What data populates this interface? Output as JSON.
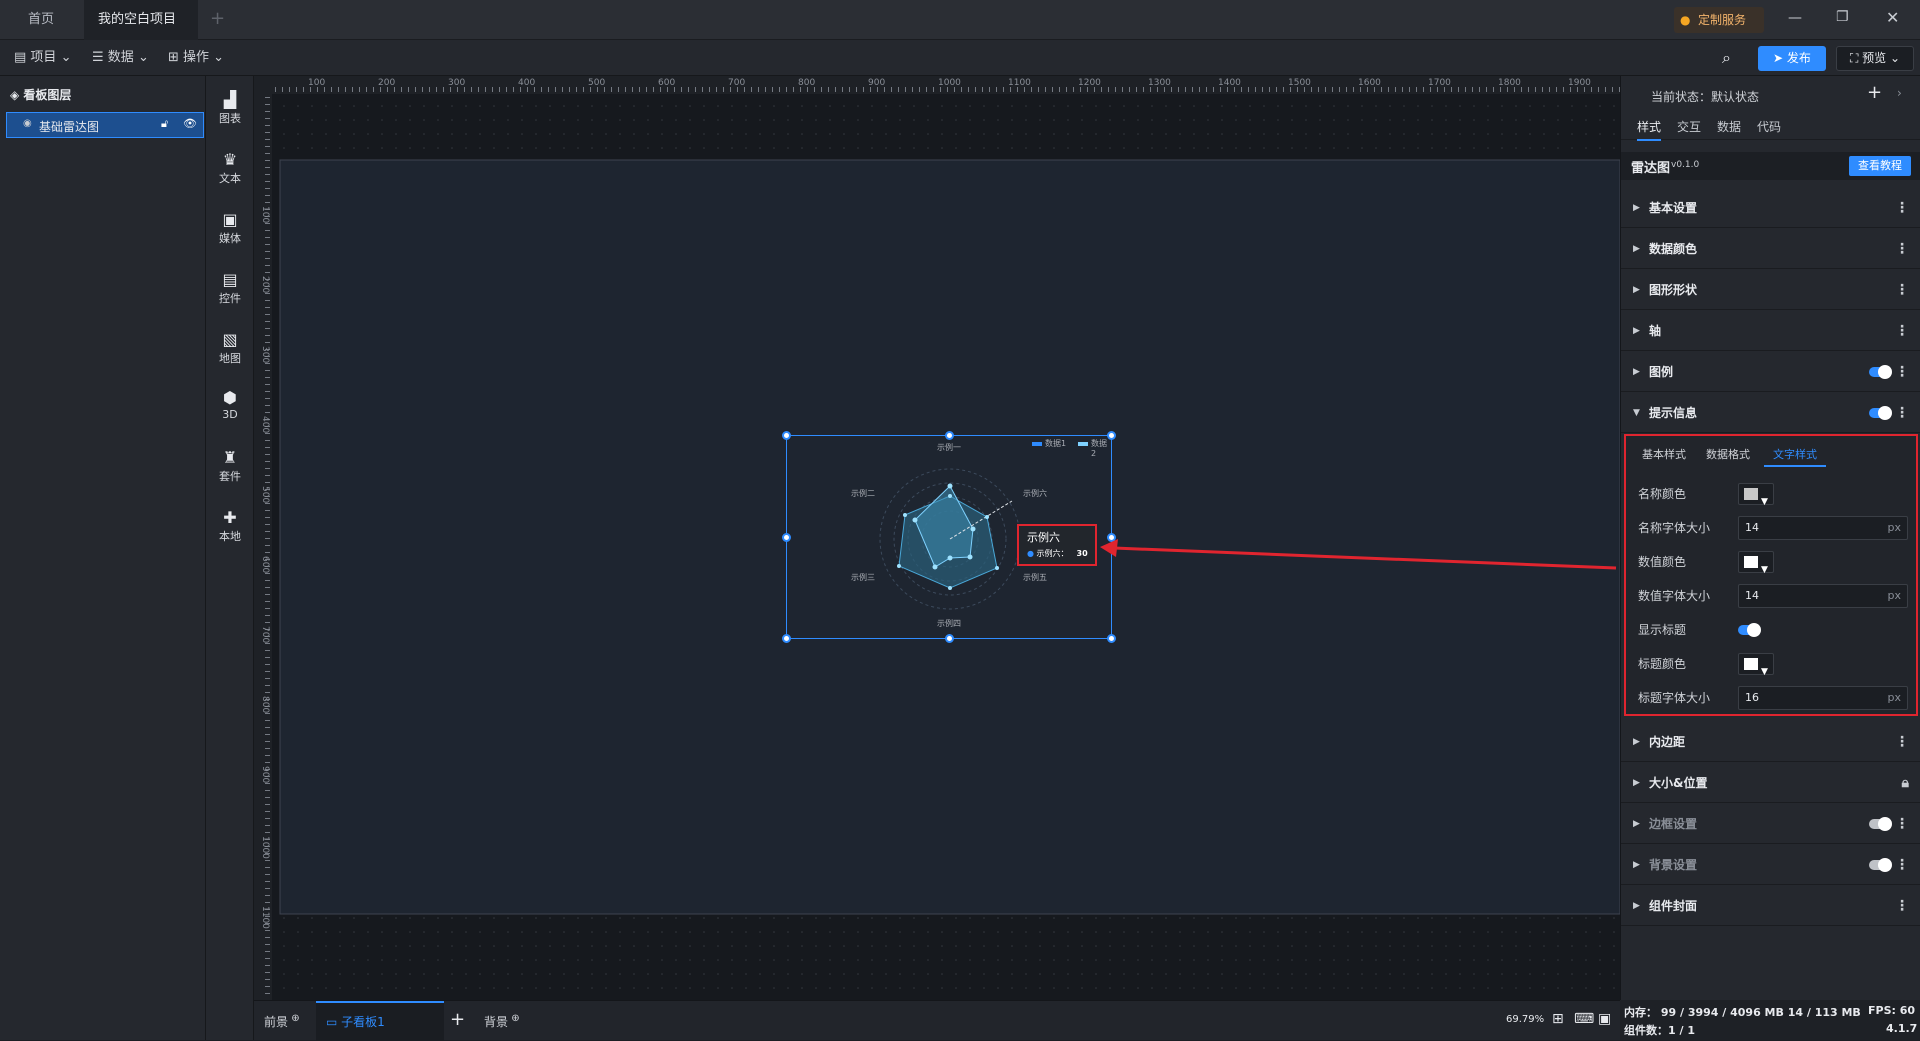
{
  "titlebar": {
    "tabs": [
      {
        "label": "首页"
      },
      {
        "label": "我的空白项目"
      }
    ],
    "custom_service": "定制服务"
  },
  "toolbar": {
    "project": "项目",
    "data": "数据",
    "operate": "操作",
    "publish": "发布",
    "preview": "预览"
  },
  "layers": {
    "title": "看板图层",
    "items": [
      {
        "label": "基础雷达图"
      }
    ]
  },
  "icon_bar": {
    "items": [
      {
        "label": "图表",
        "icon": "chart-icon"
      },
      {
        "label": "文本",
        "icon": "text-icon"
      },
      {
        "label": "媒体",
        "icon": "media-icon"
      },
      {
        "label": "控件",
        "icon": "control-icon"
      },
      {
        "label": "地图",
        "icon": "map-icon"
      },
      {
        "label": "3D",
        "icon": "cube-icon"
      },
      {
        "label": "套件",
        "icon": "kit-icon"
      },
      {
        "label": "本地",
        "icon": "puzzle-icon"
      }
    ]
  },
  "ruler": {
    "h_ticks": [
      "100",
      "200",
      "300",
      "400",
      "500",
      "600",
      "700",
      "800",
      "900",
      "1000",
      "1100",
      "1200",
      "1300",
      "1400",
      "1500",
      "1600",
      "1700",
      "1800",
      "1900"
    ],
    "v_ticks": [
      "100",
      "200",
      "300",
      "400",
      "500",
      "600",
      "700",
      "800",
      "900",
      "1000",
      "1100"
    ]
  },
  "radar": {
    "legend": [
      "数据1",
      "数据2"
    ],
    "indicators": [
      "示例一",
      "示例二",
      "示例三",
      "示例四",
      "示例五",
      "示例六"
    ],
    "tooltip_title": "示例六",
    "tooltip_label": "示例六：",
    "tooltip_value": "30"
  },
  "bottom": {
    "foreground": "前景",
    "sub_board": "子看板1",
    "background": "背景",
    "zoom": "69.79%"
  },
  "right": {
    "state_label": "当前状态：默认状态",
    "tabs": [
      "样式",
      "交互",
      "数据",
      "代码"
    ],
    "component_name": "雷达图",
    "version": "v0.1.0",
    "tutorial": "查看教程",
    "sections": [
      "基本设置",
      "数据颜色",
      "图形形状",
      "轴",
      "图例",
      "提示信息",
      "内边距",
      "大小&位置",
      "边框设置",
      "背景设置",
      "组件封面"
    ],
    "subtabs": [
      "基本样式",
      "数据格式",
      "文字样式"
    ],
    "fields": {
      "name_color": "名称颜色",
      "name_font_size": "名称字体大小",
      "name_font_size_value": "14",
      "value_color": "数值颜色",
      "value_font_size": "数值字体大小",
      "value_font_size_value": "14",
      "show_title": "显示标题",
      "title_color": "标题颜色",
      "title_font_size": "标题字体大小",
      "title_font_size_value": "16",
      "unit": "px"
    }
  },
  "status": {
    "memory": "内存：  99 / 3994 / 4096 MB  14 / 113 MB",
    "fps": "FPS:  60",
    "components": "组件数：1 / 1",
    "version": "4.1.7"
  },
  "colors": {
    "accent": "#2f8cff",
    "highlight": "#e0252f",
    "selection": "#1f7cff"
  }
}
